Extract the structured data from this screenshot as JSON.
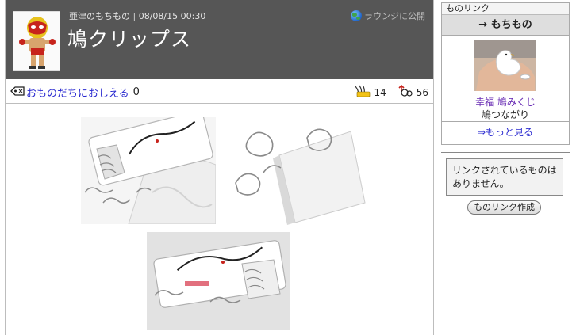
{
  "header": {
    "owner": "亜津のもちもの",
    "separator": "|",
    "timestamp": "08/08/15 00:30",
    "title": "鳩クリップス",
    "lounge_label": "ラウンジに公開"
  },
  "actions": {
    "tell_friends": "おものだちにおしえる",
    "tell_count": "0",
    "cool_count": "14",
    "mochi_count": "56"
  },
  "sidebar": {
    "header": "ものリンク",
    "mochimono_link": "→ もちもの",
    "item_name": "幸福 鳩みくじ",
    "item_sub": "鳩つながり",
    "more_link": "⇒もっと見る",
    "no_links": "リンクされているものはありません。",
    "create_button": "ものリンク作成"
  },
  "icons": {
    "avatar": "mask-figure-avatar",
    "lounge": "globe-icon",
    "tell": "tag-icon",
    "cool": "cool-badge-icon",
    "mochi": "collect-icon"
  },
  "colors": {
    "header_bg": "#565656",
    "link": "#2a2ad0",
    "item_link": "#6b2fb5"
  }
}
